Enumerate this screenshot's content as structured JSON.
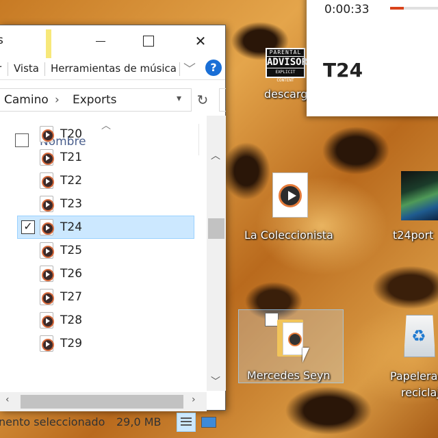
{
  "explorer": {
    "title_fragment": "s",
    "ribbon": {
      "tabs": [
        "r",
        "Vista",
        "Herramientas de música"
      ],
      "help_label": "?"
    },
    "address": {
      "crumbs": [
        "Camino",
        "Exports"
      ],
      "separator": "›"
    },
    "column_header": "Nombre",
    "files": [
      {
        "name": "T20",
        "selected": false
      },
      {
        "name": "T21",
        "selected": false
      },
      {
        "name": "T22",
        "selected": false
      },
      {
        "name": "T23",
        "selected": false
      },
      {
        "name": "T24",
        "selected": true
      },
      {
        "name": "T25",
        "selected": false
      },
      {
        "name": "T26",
        "selected": false
      },
      {
        "name": "T27",
        "selected": false
      },
      {
        "name": "T28",
        "selected": false
      },
      {
        "name": "T29",
        "selected": false
      }
    ],
    "status": {
      "text": "nento seleccionado",
      "size": "29,0 MB"
    }
  },
  "desktop": {
    "icons": [
      {
        "label": "descarg",
        "icon": "parental-advisory-icon"
      },
      {
        "label": "La Coleccionista",
        "icon": "audio-file-icon"
      },
      {
        "label": "t24port",
        "icon": "image-thumbnail-icon"
      },
      {
        "label": "Mercedes Seyn",
        "icon": "folder-icon"
      },
      {
        "label": "Papelera",
        "label2": "reciclaj",
        "icon": "recycle-bin-icon"
      }
    ],
    "parental_advisory": {
      "line1": "PARENTAL",
      "line2": "ADVISORY",
      "line3": "EXPLICIT CONTENT"
    }
  },
  "player": {
    "elapsed": "0:00:33",
    "track": "T24",
    "progress_fraction": 0.25,
    "accent_color": "#d9431a"
  }
}
